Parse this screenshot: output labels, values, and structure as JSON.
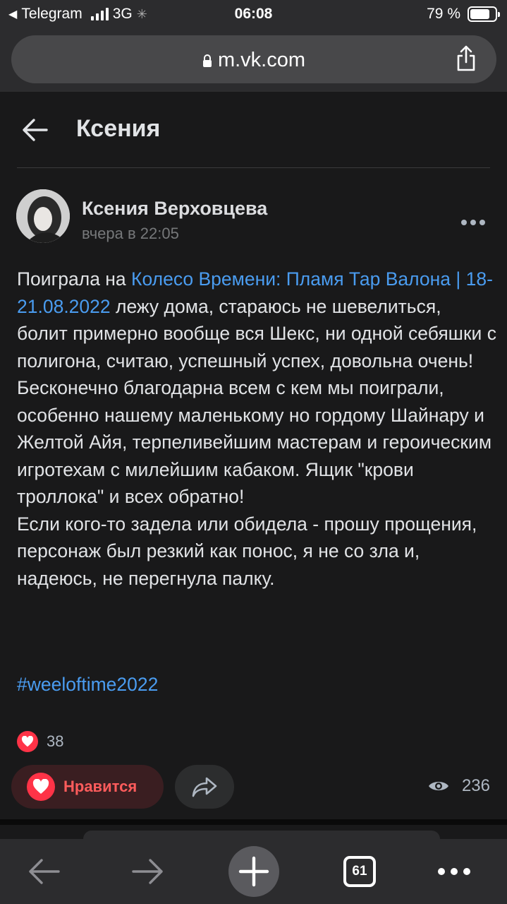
{
  "status_bar": {
    "back_app": "Telegram",
    "network": "3G",
    "time": "06:08",
    "battery": "79 %",
    "battery_level": 0.79
  },
  "browser": {
    "url": "m.vk.com"
  },
  "page": {
    "title": "Ксения"
  },
  "post": {
    "author": "Ксения Верховцева",
    "time": "вчера в 22:05",
    "text_before_link": "Поиграла на ",
    "link_text": "Колесо Времени: Пламя Тар Валона | 18-21.08.2022",
    "text_after_link": " лежу дома, стараюсь не шевелиться, болит примерно вообще вся Шекс, ни одной себяшки с полигона, считаю, успешный успех, довольна очень!\nБесконечно благодарна всем с кем мы поиграли, особенно нашему маленькому но гордому Шайнару и Желтой Айя, терпеливейшим мастерам и героическим игротехам с милейшим кабаком. Ящик \"крови троллока\" и всех обратно!\nЕсли кого-то задела или обидела - прошу прощения, персонаж был резкий как понос, я не со зла и, надеюсь, не перегнула палку.",
    "hashtag": "#weeloftime2022",
    "likes": "38",
    "like_label": "Нравится",
    "views": "236"
  },
  "toolbar": {
    "tabs_count": "61"
  },
  "colors": {
    "background": "#19191a",
    "link": "#4a9cf0",
    "like_red": "#ff3347"
  }
}
